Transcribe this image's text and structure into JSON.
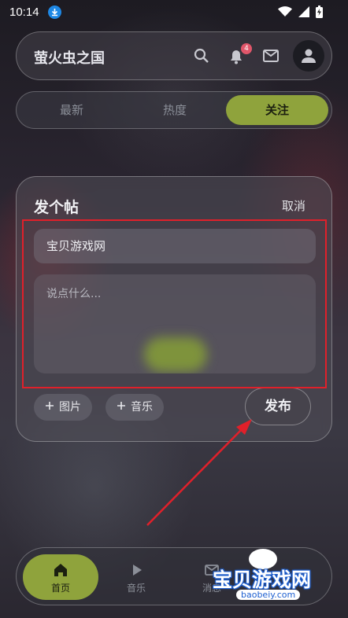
{
  "status_bar": {
    "time": "10:14"
  },
  "header": {
    "title": "萤火虫之国",
    "notification_count": "4"
  },
  "tabs": [
    {
      "label": "最新"
    },
    {
      "label": "热度"
    },
    {
      "label": "关注"
    }
  ],
  "dialog": {
    "title": "发个帖",
    "cancel_label": "取消",
    "title_value": "宝贝游戏网",
    "body_placeholder": "说点什么...",
    "add_image_label": "图片",
    "add_music_label": "音乐",
    "publish_label": "发布"
  },
  "bottom_nav": [
    {
      "label": "首页",
      "icon": "home-icon"
    },
    {
      "label": "音乐",
      "icon": "play-icon"
    },
    {
      "label": "消息",
      "icon": "mail-icon"
    }
  ],
  "watermark": {
    "text": "宝贝游戏网",
    "url": "baobeiy.com"
  },
  "colors": {
    "accent": "#8fa33c",
    "annotation": "#e0202a",
    "badge": "#e0566a"
  }
}
